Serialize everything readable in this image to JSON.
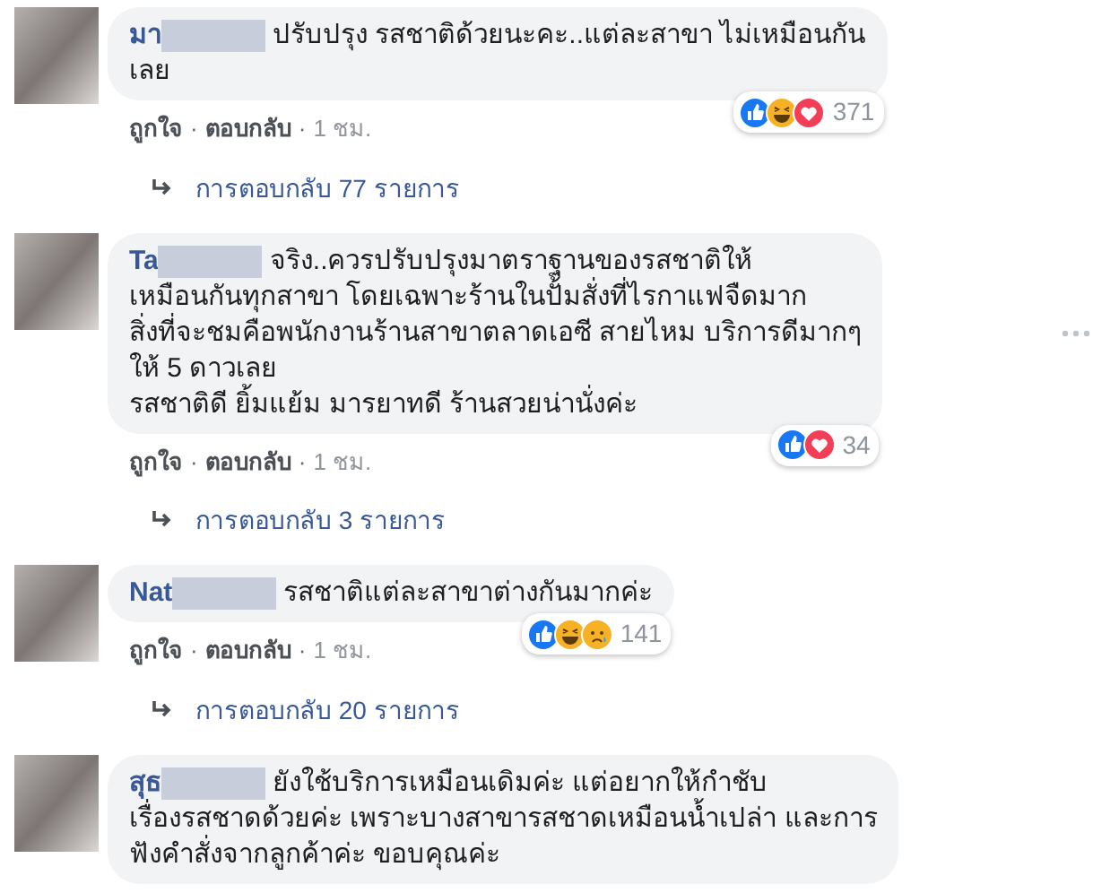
{
  "comments": [
    {
      "name_visible": "มา",
      "text_lines": [
        "ปรับปรุง รสชาติด้วยนะคะ..แต่ละสาขา ไม่เหมือนกัน",
        "เลย"
      ],
      "reactions": [
        {
          "kind": "like"
        },
        {
          "kind": "haha"
        },
        {
          "kind": "love"
        }
      ],
      "reaction_count": "371",
      "actions": [
        {
          "kind": "link",
          "text": "ถูกใจ"
        },
        {
          "kind": "separator",
          "text": "·"
        },
        {
          "kind": "link",
          "text": "ตอบกลับ"
        },
        {
          "kind": "separator",
          "text": "·"
        },
        {
          "kind": "time",
          "text": "1 ชม."
        }
      ],
      "replies": "การตอบกลับ 77 รายการ",
      "more_menu": false
    },
    {
      "name_visible": "Ta",
      "text_lines": [
        "จริง..ควรปรับปรุงมาตราฐานของรสชาติให้",
        "เหมือนกันทุกสาขา โดยเฉพาะร้านในปั้มสั่งที่ไรกาแฟจืดมาก",
        "สิ่งที่จะชมคือพนักงานร้านสาขาตลาดเอซี สายไหม บริการดีมากๆ",
        "ให้ 5 ดาวเลย",
        "รสชาติดี ยิ้มแย้ม มารยาทดี ร้านสวยน่านั่งค่ะ"
      ],
      "reactions": [
        {
          "kind": "like"
        },
        {
          "kind": "love"
        }
      ],
      "reaction_count": "34",
      "actions": [
        {
          "kind": "link",
          "text": "ถูกใจ"
        },
        {
          "kind": "separator",
          "text": "·"
        },
        {
          "kind": "link",
          "text": "ตอบกลับ"
        },
        {
          "kind": "separator",
          "text": "·"
        },
        {
          "kind": "time",
          "text": "1 ชม."
        }
      ],
      "replies": "การตอบกลับ 3 รายการ",
      "more_menu": true
    },
    {
      "name_visible": "Nat",
      "text_lines": [
        "รสชาติแต่ละสาขาต่างกันมากค่ะ"
      ],
      "reactions": [
        {
          "kind": "like"
        },
        {
          "kind": "haha"
        },
        {
          "kind": "sad"
        }
      ],
      "reaction_count": "141",
      "actions": [
        {
          "kind": "link",
          "text": "ถูกใจ"
        },
        {
          "kind": "separator",
          "text": "·"
        },
        {
          "kind": "link",
          "text": "ตอบกลับ"
        },
        {
          "kind": "separator",
          "text": "·"
        },
        {
          "kind": "time",
          "text": "1 ชม."
        }
      ],
      "replies": "การตอบกลับ 20 รายการ",
      "more_menu": false
    },
    {
      "name_visible": "สุธ",
      "text_lines": [
        "ยังใช้บริการเหมือนเดิมค่ะ แต่อยากให้กำชับ",
        "เรื่องรสชาดด้วยค่ะ เพราะบางสาขารสชาดเหมือนน้ำเปล่า และการ",
        "ฟังคำสั่งจากลูกค้าค่ะ ขอบคุณค่ะ"
      ],
      "more_menu": false
    }
  ]
}
